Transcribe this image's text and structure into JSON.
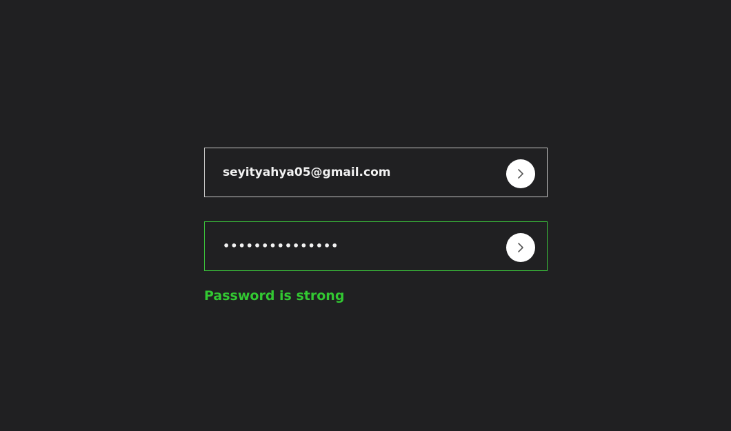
{
  "email": {
    "value": "seyityahya05@gmail.com",
    "button_icon": "chevron-right-icon",
    "border_color": "#c9c9c9"
  },
  "password": {
    "value": "•••••••••••••••",
    "button_icon": "chevron-right-icon",
    "border_color": "#3bc43b"
  },
  "status": {
    "text": "Password is strong",
    "color": "#32c832"
  },
  "colors": {
    "background": "#202022",
    "button": "#ffffff",
    "chevron": "#555555"
  }
}
